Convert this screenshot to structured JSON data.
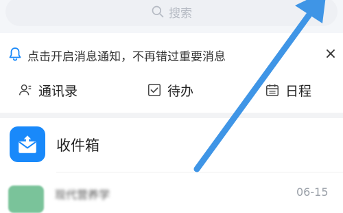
{
  "search": {
    "placeholder": "搜索"
  },
  "notice": {
    "text": "点击开启消息通知，不再错过重要消息",
    "close": "×"
  },
  "tabs": [
    {
      "label": "通讯录",
      "icon": "contacts-icon"
    },
    {
      "label": "待办",
      "icon": "checkbox-icon"
    },
    {
      "label": "日程",
      "icon": "calendar-icon"
    }
  ],
  "inbox": {
    "label": "收件箱",
    "icon": "inbox-icon",
    "color": "#1989fa"
  },
  "mail_item": {
    "sender": "现代营养学",
    "date": "06-15"
  },
  "colors": {
    "accent": "#1989fa",
    "arrow": "#3f95e6"
  }
}
